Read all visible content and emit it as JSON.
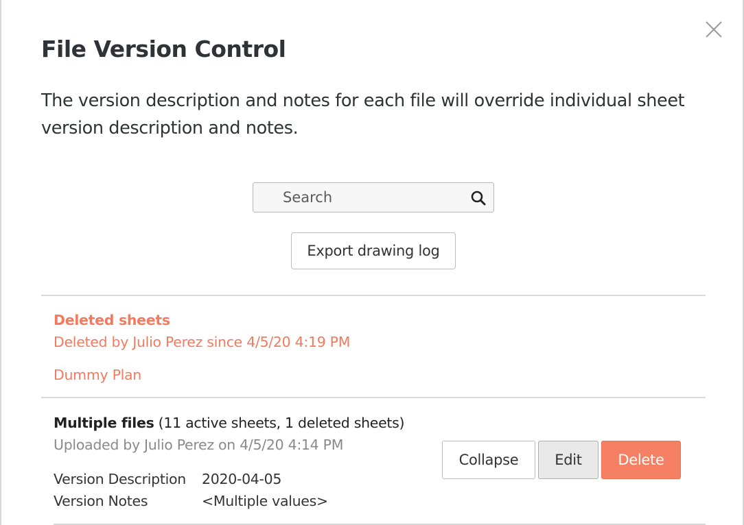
{
  "dialog": {
    "title": "File Version Control",
    "intro": "The version description and notes for each file will override individual sheet version description and notes."
  },
  "search": {
    "placeholder": "Search"
  },
  "export_button": "Export drawing log",
  "deleted": {
    "title": "Deleted sheets",
    "by": "Deleted by Julio Perez since 4/5/20 4:19 PM",
    "items": [
      "Dummy Plan"
    ]
  },
  "file_group": {
    "name": "Multiple files",
    "summary": " (11 active sheets, 1 deleted sheets)",
    "uploaded": "Uploaded by Julio Perez on 4/5/20 4:14 PM",
    "version_description_label": "Version Description",
    "version_description": "2020-04-05",
    "version_notes_label": "Version Notes",
    "version_notes": "<Multiple values>",
    "buttons": {
      "collapse": "Collapse",
      "edit": "Edit",
      "delete": "Delete"
    }
  },
  "colors": {
    "accent": "#f47a5e",
    "delete_button": "#f57f62"
  },
  "icons": [
    "close-icon",
    "search-icon"
  ]
}
